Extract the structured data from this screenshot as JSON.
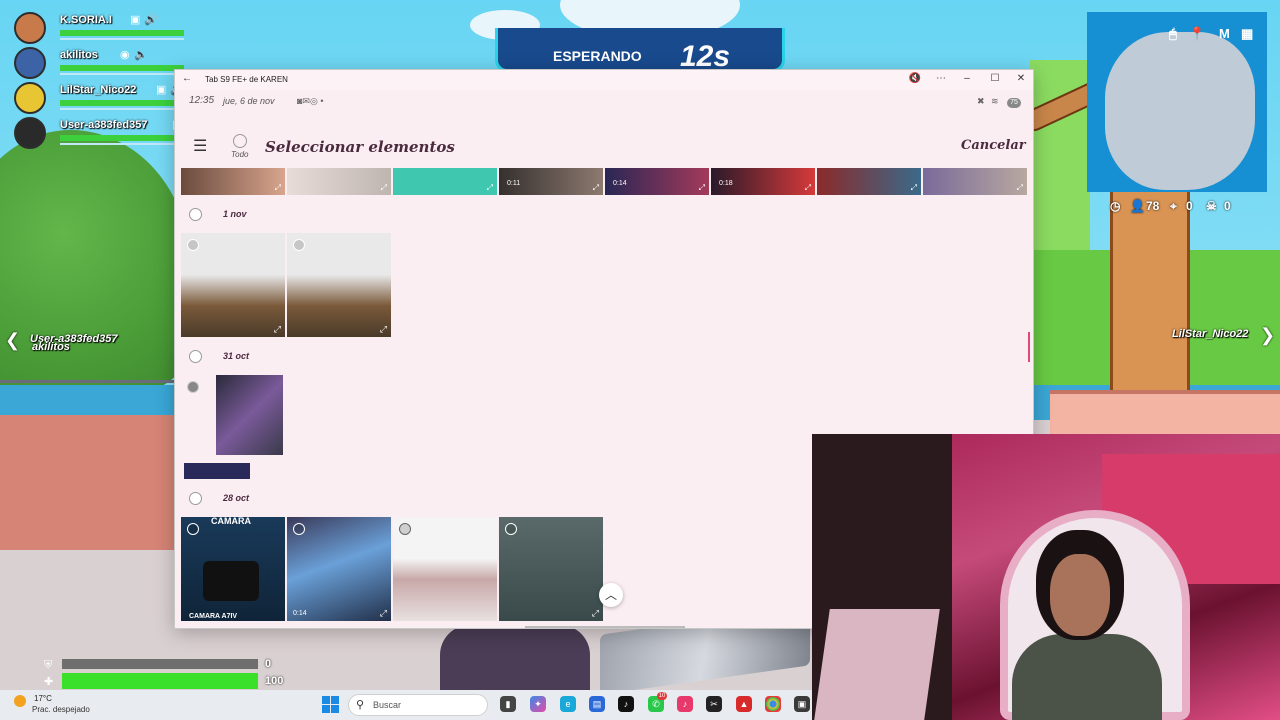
{
  "game": {
    "banner_label": "ESPERANDO",
    "banner_timer": "12s",
    "players": [
      {
        "name": "K.SORIA.I",
        "avatar_color": "#c97a4a"
      },
      {
        "name": "akilitos",
        "avatar_color": "#3b63a6"
      },
      {
        "name": "LilStar_Nico22",
        "avatar_color": "#e8c533"
      },
      {
        "name": "User-a383fed357",
        "avatar_color": "#2a2a2a"
      }
    ],
    "left_tag_1": "User-a383fed357",
    "left_tag_2": "akilitos",
    "right_tag": "LilStar_Nico22",
    "map_letter": "M",
    "stats": {
      "players": "78",
      "eliminations": "0",
      "assists": "0"
    },
    "shield": "0",
    "health": "100",
    "health_fraction": 1.0
  },
  "window": {
    "title": "Tab S9 FE+ de KAREN",
    "status_time": "12:35",
    "status_date": "jue, 6 de nov",
    "battery": "75"
  },
  "gallery": {
    "select_all_label": "Todo",
    "title": "Seleccionar elementos",
    "cancel_label": "Cancelar",
    "strip_durations": [
      "",
      "",
      "",
      "0:11",
      "0:14",
      "0:18",
      "",
      ""
    ],
    "groups": [
      {
        "date": "1 nov"
      },
      {
        "date": "31 oct"
      },
      {
        "date": "28 oct"
      }
    ],
    "tile_durations": {
      "oct28_second": "0:14"
    },
    "camera_text": "CAMARA",
    "camera_caption": "CAMARA A7IV"
  },
  "taskbar": {
    "weather_temp": "17°C",
    "weather_desc": "Prac. despejado",
    "search_placeholder": "Buscar",
    "badge_count": "10"
  },
  "colors": {
    "window_bg": "#fbeef3",
    "title_text": "#4a2a3d",
    "health_green": "#3ae02a",
    "minimap_water": "#1690d2"
  }
}
